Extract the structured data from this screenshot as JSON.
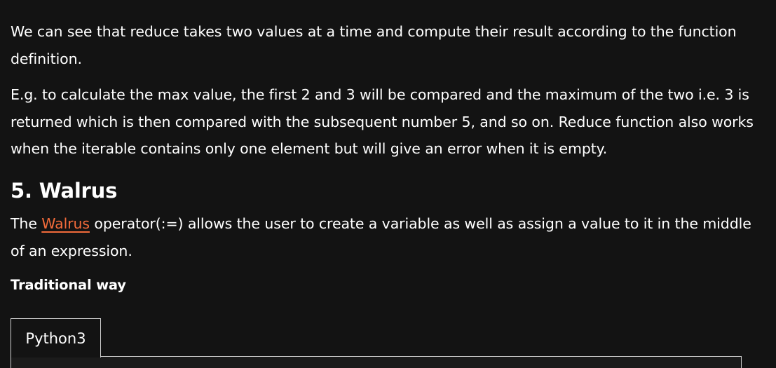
{
  "paragraph_reduce": "We can see that reduce takes two values at a time and compute their result according to the function definition.",
  "paragraph_example": "E.g. to calculate the max value, the first 2 and 3 will be compared and the maximum of the two i.e. 3 is returned which is then compared with the subsequent number 5, and so on.  Reduce function also works when the iterable contains only one element but will give an error when it is empty.",
  "section_heading": "5. Walrus",
  "walrus_paragraph": {
    "before": "The ",
    "link_text": "Walrus",
    "after": " operator(:=) allows the user to create a variable as well as assign a value to it in the middle of an expression."
  },
  "traditional_label": "Traditional way",
  "code_tab_label": "Python3",
  "colors": {
    "background": "#131313",
    "text": "#ffffff",
    "link": "#f26b3a",
    "border": "#cfcfcf"
  }
}
